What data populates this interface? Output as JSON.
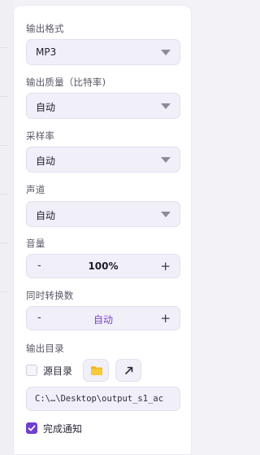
{
  "output_format": {
    "label": "输出格式",
    "value": "MP3"
  },
  "output_quality": {
    "label": "输出质量（比特率)",
    "value": "自动"
  },
  "sample_rate": {
    "label": "采样率",
    "value": "自动"
  },
  "channels": {
    "label": "声道",
    "value": "自动"
  },
  "volume": {
    "label": "音量",
    "value": "100%",
    "decrement": "-",
    "increment": "+"
  },
  "concurrency": {
    "label": "同时转换数",
    "value": "自动",
    "decrement": "-",
    "increment": "+"
  },
  "output_dir": {
    "label": "输出目录",
    "source_dir_label": "源目录",
    "source_dir_checked": false,
    "path": "C:\\…\\Desktop\\output_s1_ac",
    "folder_icon": "folder-icon",
    "open_icon": "arrow-up-right-icon"
  },
  "notify": {
    "label": "完成通知",
    "checked": true
  },
  "colors": {
    "accent": "#6f3fcf",
    "folder": "#f2b824"
  }
}
